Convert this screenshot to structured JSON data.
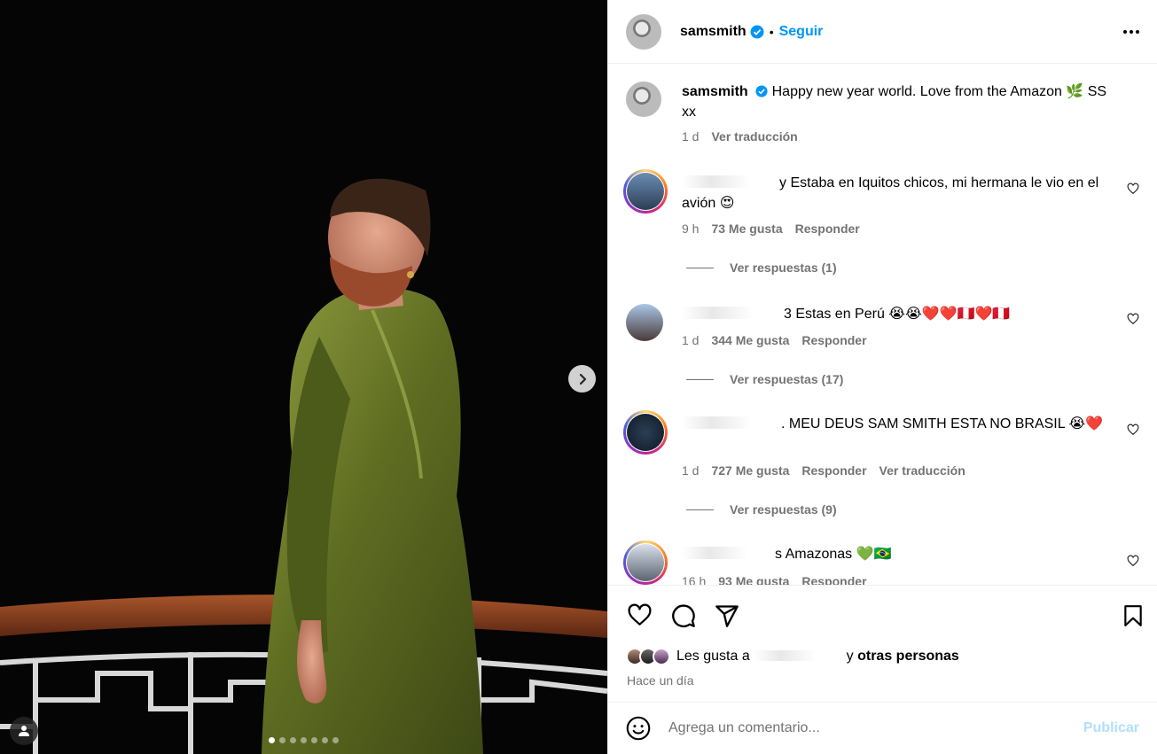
{
  "post": {
    "author": "samsmith",
    "follow_label": "Seguir",
    "separator": "•",
    "more_icon": "more-options-icon"
  },
  "carousel": {
    "slide_count": 7,
    "active_index": 0,
    "next_icon": "chevron-right-icon",
    "tag_icon": "user-tag-icon"
  },
  "caption": {
    "author": "samsmith",
    "text": "Happy new year world. Love from the Amazon 🌿 SS xx",
    "age": "1 d",
    "translate": "Ver traducción"
  },
  "comments": [
    {
      "text": "y Estaba en Iquitos chicos, mi hermana le vio en el avión 😍",
      "age": "9 h",
      "likes": "73 Me gusta",
      "reply": "Responder",
      "replies": "Ver respuestas (1)"
    },
    {
      "text": "3 Estas en Perú 😭😭❤️❤️🇵🇪❤️🇵🇪",
      "age": "1 d",
      "likes": "344 Me gusta",
      "reply": "Responder",
      "replies": "Ver respuestas (17)"
    },
    {
      "text": ". MEU DEUS SAM SMITH ESTA NO BRASIL 😭❤️",
      "age": "1 d",
      "likes": "727 Me gusta",
      "reply": "Responder",
      "translate": "Ver traducción",
      "replies": "Ver respuestas (9)"
    },
    {
      "text": "s Amazonas 💚🇧🇷",
      "age": "16 h",
      "likes": "93 Me gusta",
      "reply": "Responder"
    }
  ],
  "actions": {
    "like_icon": "heart-icon",
    "comment_icon": "comment-icon",
    "share_icon": "send-icon",
    "save_icon": "bookmark-icon"
  },
  "likes_summary": {
    "prefix": "Les gusta a",
    "connector": "y",
    "others": "otras personas"
  },
  "posted": "Hace un día",
  "composer": {
    "placeholder": "Agrega un comentario...",
    "publish": "Publicar",
    "emoji_icon": "emoji-icon"
  },
  "colors": {
    "accent": "#0095f6",
    "publish_disabled": "#b2dffc",
    "muted": "#737373",
    "dress": "#6d7d2c"
  }
}
